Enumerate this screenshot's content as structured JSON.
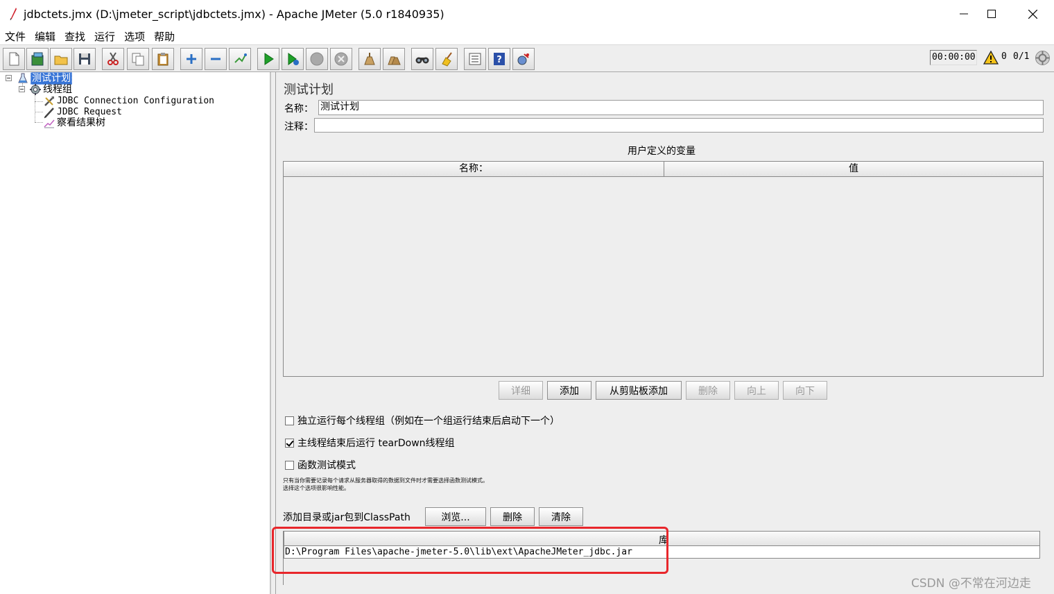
{
  "window": {
    "title": "jdbctets.jmx (D:\\jmeter_script\\jdbctets.jmx) - Apache JMeter (5.0 r1840935)",
    "minimize_glyph": "—",
    "maximize_glyph": "☐",
    "close_glyph": "✕"
  },
  "menu": [
    "文件",
    "编辑",
    "查找",
    "运行",
    "选项",
    "帮助"
  ],
  "toolbar": {
    "buttons": [
      "new-icon",
      "templates-icon",
      "open-icon",
      "save-icon",
      "cut-icon",
      "copy-icon",
      "paste-icon",
      "expand-icon",
      "collapse-icon",
      "toggle-icon",
      "start-icon",
      "start-no-pause-icon",
      "stop-icon",
      "shutdown-icon",
      "clear-icon",
      "clear-all-icon",
      "search-icon",
      "reset-search-icon",
      "function-helper-icon",
      "help-icon",
      "remote-icon"
    ],
    "timer": "00:00:00",
    "warning_count": "0",
    "thread_count": "0/1"
  },
  "tree": {
    "root": "测试计划",
    "thread_group": "线程组",
    "children": [
      "JDBC Connection Configuration",
      "JDBC Request",
      "察看结果树"
    ]
  },
  "test_plan": {
    "heading": "测试计划",
    "name_label": "名称：",
    "name_value": "测试计划",
    "comment_label": "注释：",
    "comment_value": "",
    "vars_title": "用户定义的变量",
    "vars_columns": [
      "名称：",
      "值"
    ],
    "buttons": {
      "detail": "详细",
      "add": "添加",
      "add_clipboard": "从剪贴板添加",
      "delete": "删除",
      "up": "向上",
      "down": "向下"
    },
    "options": [
      {
        "label": "独立运行每个线程组（例如在一个组运行结束后启动下一个）",
        "checked": false
      },
      {
        "label": "主线程结束后运行 tearDown线程组",
        "checked": true
      },
      {
        "label": "函数测试模式",
        "checked": false
      }
    ],
    "note_line1": "只有当你需要记录每个请求从服务器取得的数据到文件时才需要选择函数测试模式。",
    "note_line2": "选择这个选项很影响性能。",
    "classpath_label": "添加目录或jar包到ClassPath",
    "classpath_buttons": {
      "browse": "浏览...",
      "delete": "删除",
      "clear": "清除"
    },
    "library_header": "库",
    "library_rows": [
      "D:\\Program Files\\apache-jmeter-5.0\\lib\\ext\\ApacheJMeter_jdbc.jar"
    ]
  },
  "watermark": "CSDN @不常在河边走",
  "colors": {
    "selection": "#3875d7",
    "highlight_box": "#e8262b",
    "panel_bg": "#eeeeee"
  }
}
